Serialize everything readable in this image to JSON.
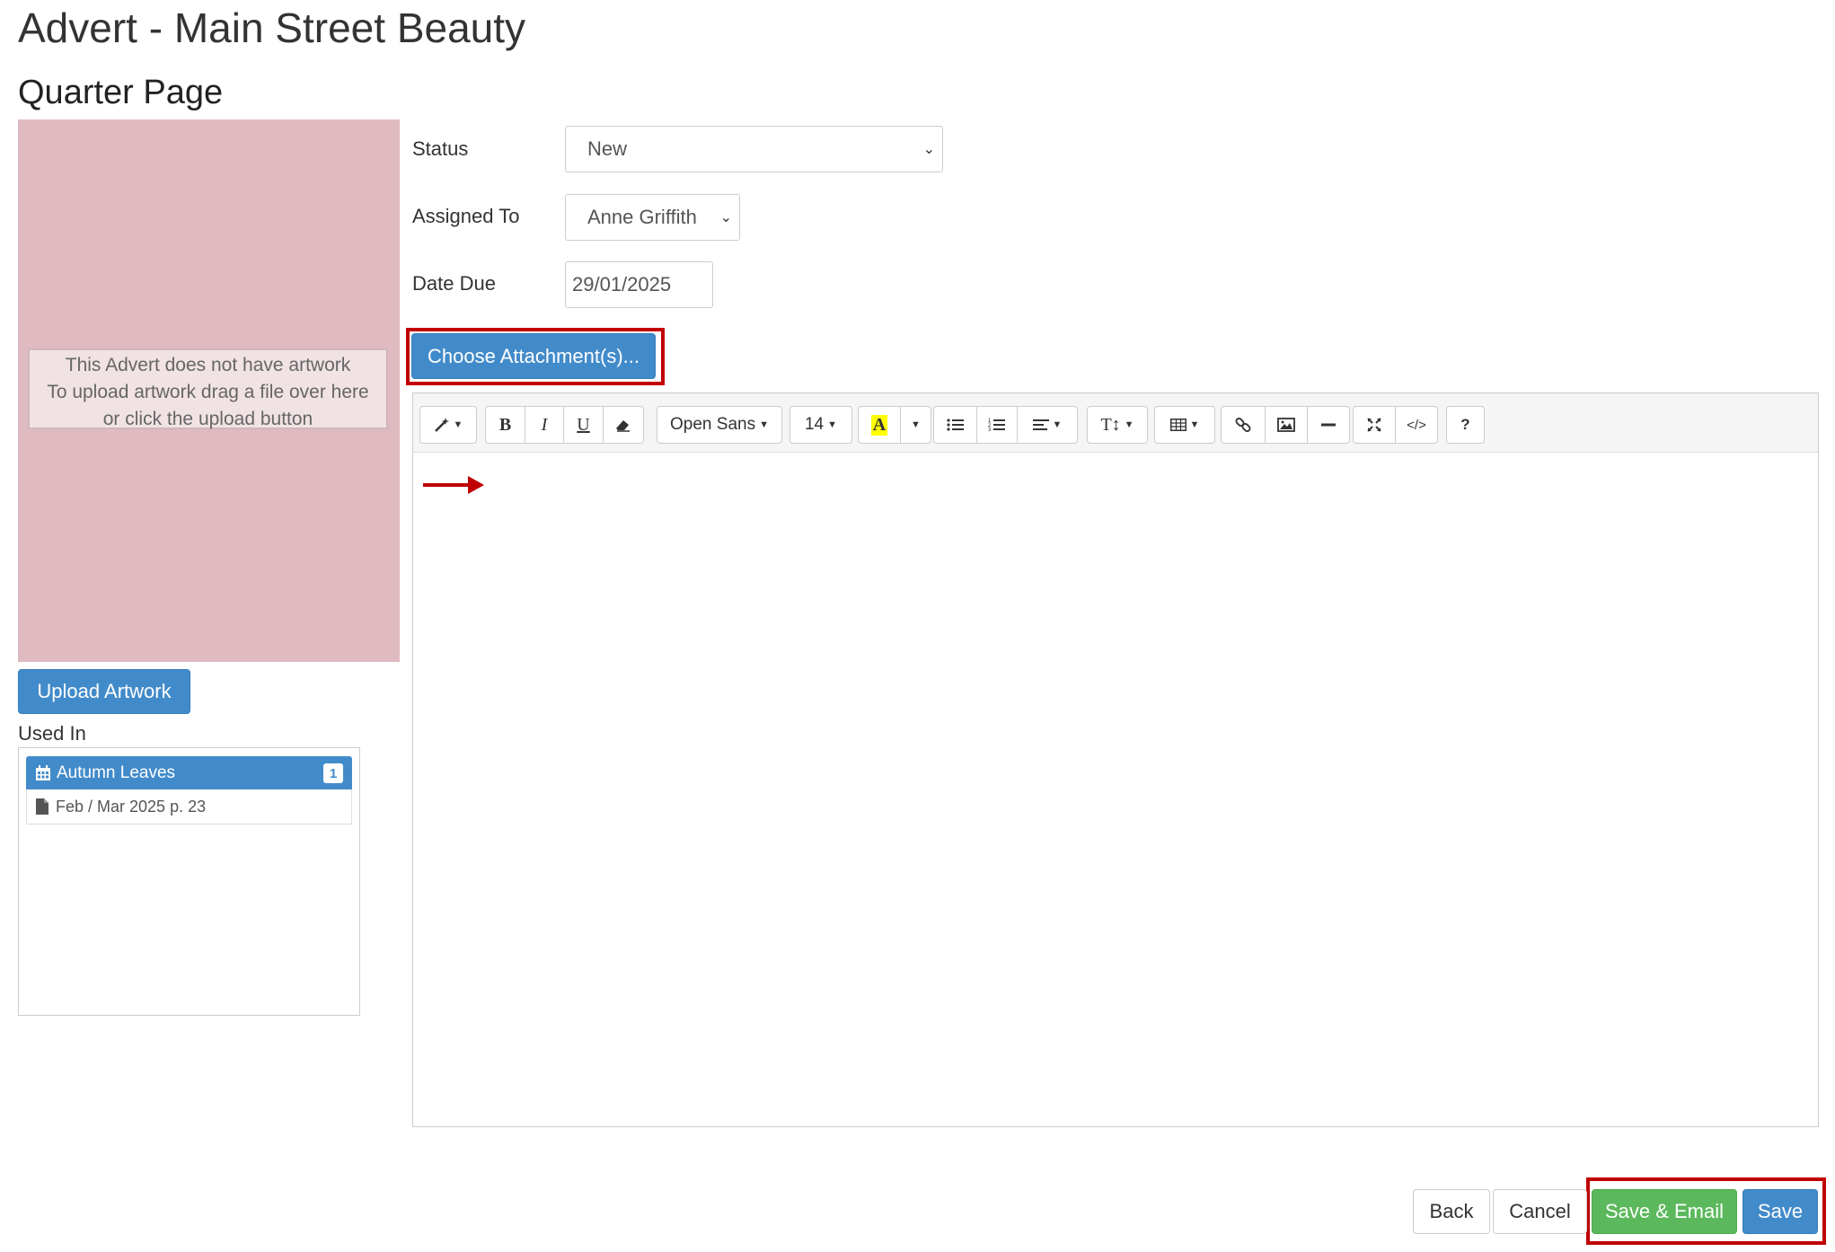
{
  "page": {
    "title": "Advert - Main Street Beauty",
    "subtitle": "Quarter Page"
  },
  "artwork": {
    "message_line1": "This Advert does not have artwork",
    "message_line2": "To upload artwork drag a file over here",
    "message_line3": "or click the upload button",
    "upload_label": "Upload Artwork",
    "bg_color": "#dfbbc1"
  },
  "used_in": {
    "label": "Used In",
    "publication": "Autumn Leaves",
    "count": "1",
    "issue": "Feb / Mar 2025 p. 23"
  },
  "form": {
    "status_label": "Status",
    "status_value": "New",
    "assigned_label": "Assigned To",
    "assigned_value": "Anne Griffith",
    "date_due_label": "Date Due",
    "date_due_value": "29/01/2025",
    "attach_label": "Choose Attachment(s)..."
  },
  "toolbar": {
    "font_name": "Open Sans",
    "font_size": "14",
    "help": "?"
  },
  "footer": {
    "back": "Back",
    "cancel": "Cancel",
    "save_email": "Save & Email",
    "save": "Save"
  },
  "colors": {
    "primary": "#428bca",
    "success": "#5cb85c",
    "highlight": "#c00000"
  }
}
